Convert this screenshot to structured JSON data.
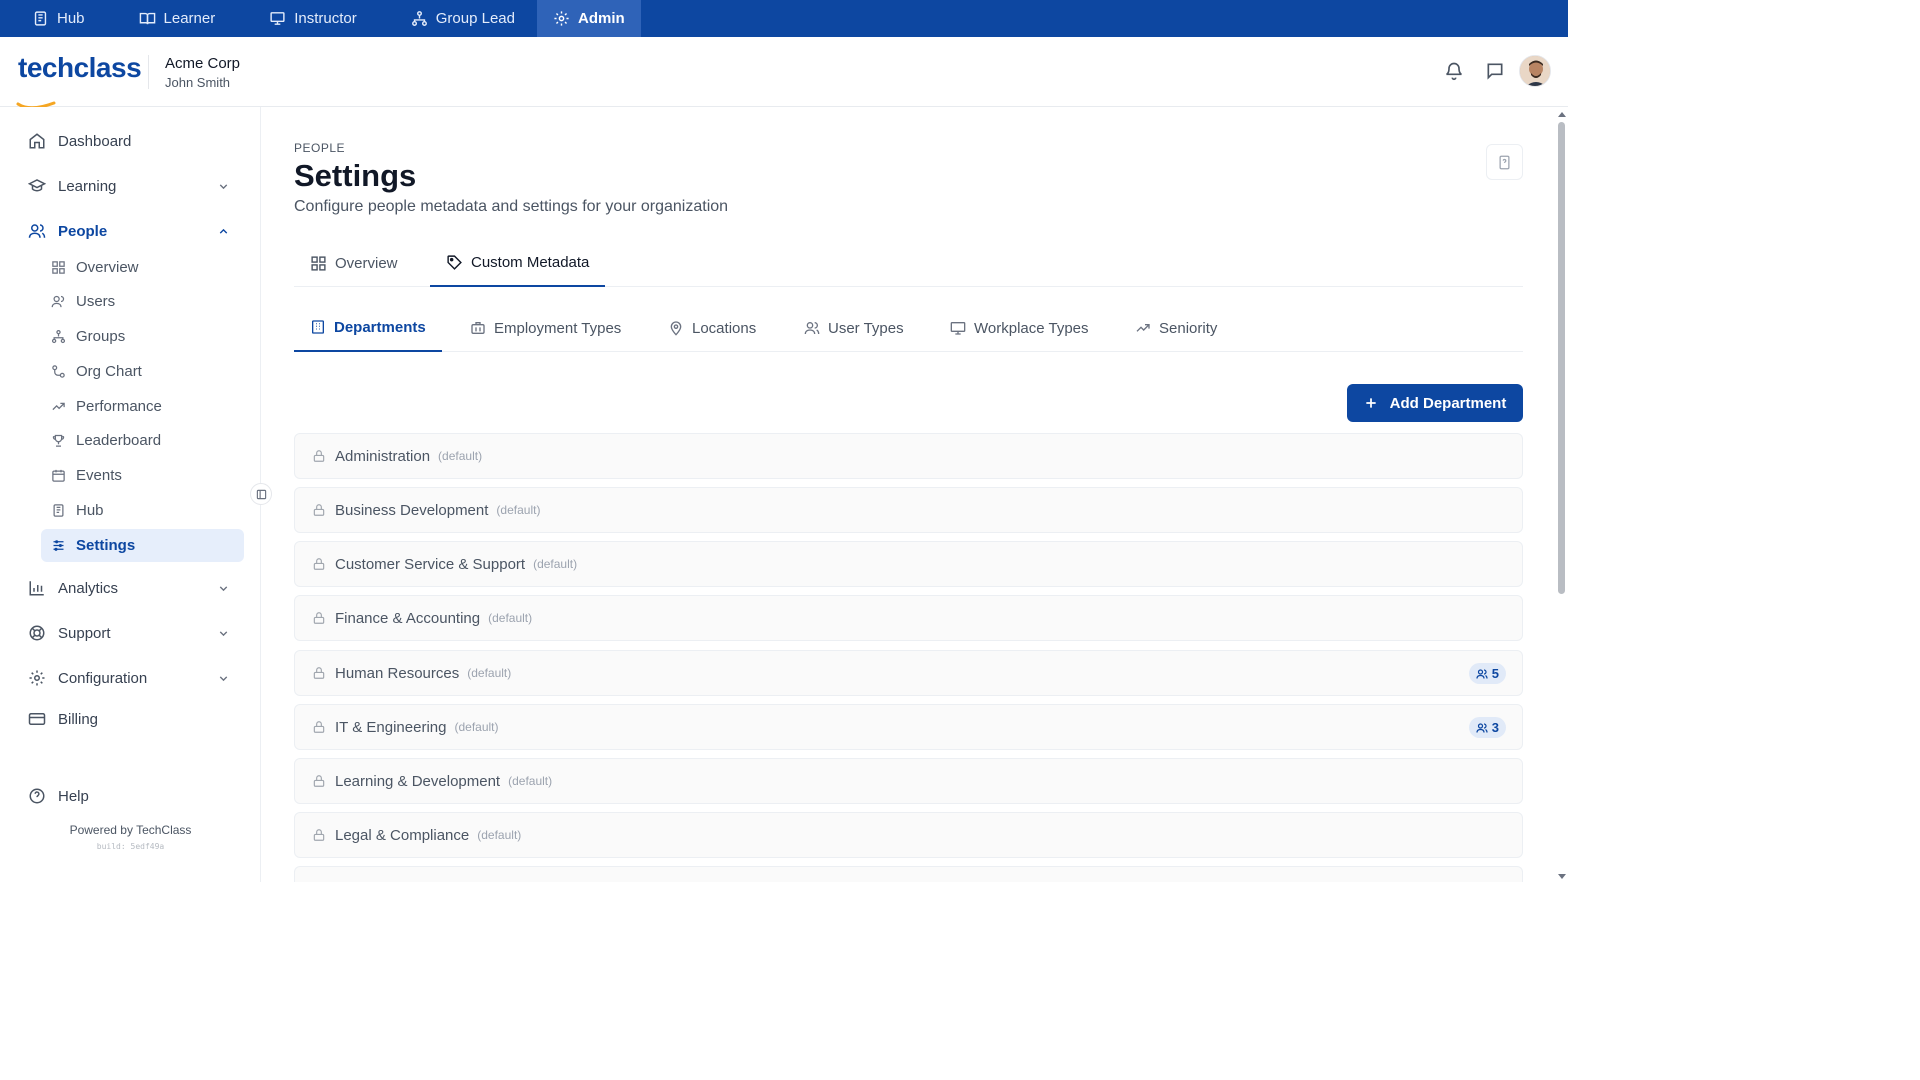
{
  "topnav": {
    "items": [
      {
        "label": "Hub",
        "icon": "book-stack-icon"
      },
      {
        "label": "Learner",
        "icon": "open-book-icon"
      },
      {
        "label": "Instructor",
        "icon": "presentation-icon"
      },
      {
        "label": "Group Lead",
        "icon": "hierarchy-icon"
      },
      {
        "label": "Admin",
        "icon": "gear-icon",
        "active": true
      }
    ]
  },
  "header": {
    "logo": "techclass",
    "org_name": "Acme Corp",
    "user_name": "John Smith"
  },
  "sidebar": {
    "dashboard": "Dashboard",
    "learning": "Learning",
    "people": "People",
    "people_items": [
      "Overview",
      "Users",
      "Groups",
      "Org Chart",
      "Performance",
      "Leaderboard",
      "Events",
      "Hub",
      "Settings"
    ],
    "analytics": "Analytics",
    "support": "Support",
    "configuration": "Configuration",
    "billing": "Billing",
    "help": "Help",
    "powered_by": "Powered by TechClass",
    "build": "build: 5edf49a"
  },
  "page": {
    "eyebrow": "PEOPLE",
    "title": "Settings",
    "subtitle": "Configure people metadata and settings for your organization"
  },
  "tabs": {
    "overview": "Overview",
    "custom_metadata": "Custom Metadata"
  },
  "subtabs": {
    "departments": "Departments",
    "employment_types": "Employment Types",
    "locations": "Locations",
    "user_types": "User Types",
    "workplace_types": "Workplace Types",
    "seniority": "Seniority"
  },
  "add_button": "Add Department",
  "default_tag": "(default)",
  "departments": [
    {
      "name": "Administration"
    },
    {
      "name": "Business Development"
    },
    {
      "name": "Customer Service & Support"
    },
    {
      "name": "Finance & Accounting"
    },
    {
      "name": "Human Resources",
      "count": "5"
    },
    {
      "name": "IT & Engineering",
      "count": "3"
    },
    {
      "name": "Learning & Development"
    },
    {
      "name": "Legal & Compliance"
    }
  ],
  "colors": {
    "brand": "#0d47a1",
    "topnav_active": "#2f63b8",
    "logo_swoosh": "#f5a623"
  }
}
